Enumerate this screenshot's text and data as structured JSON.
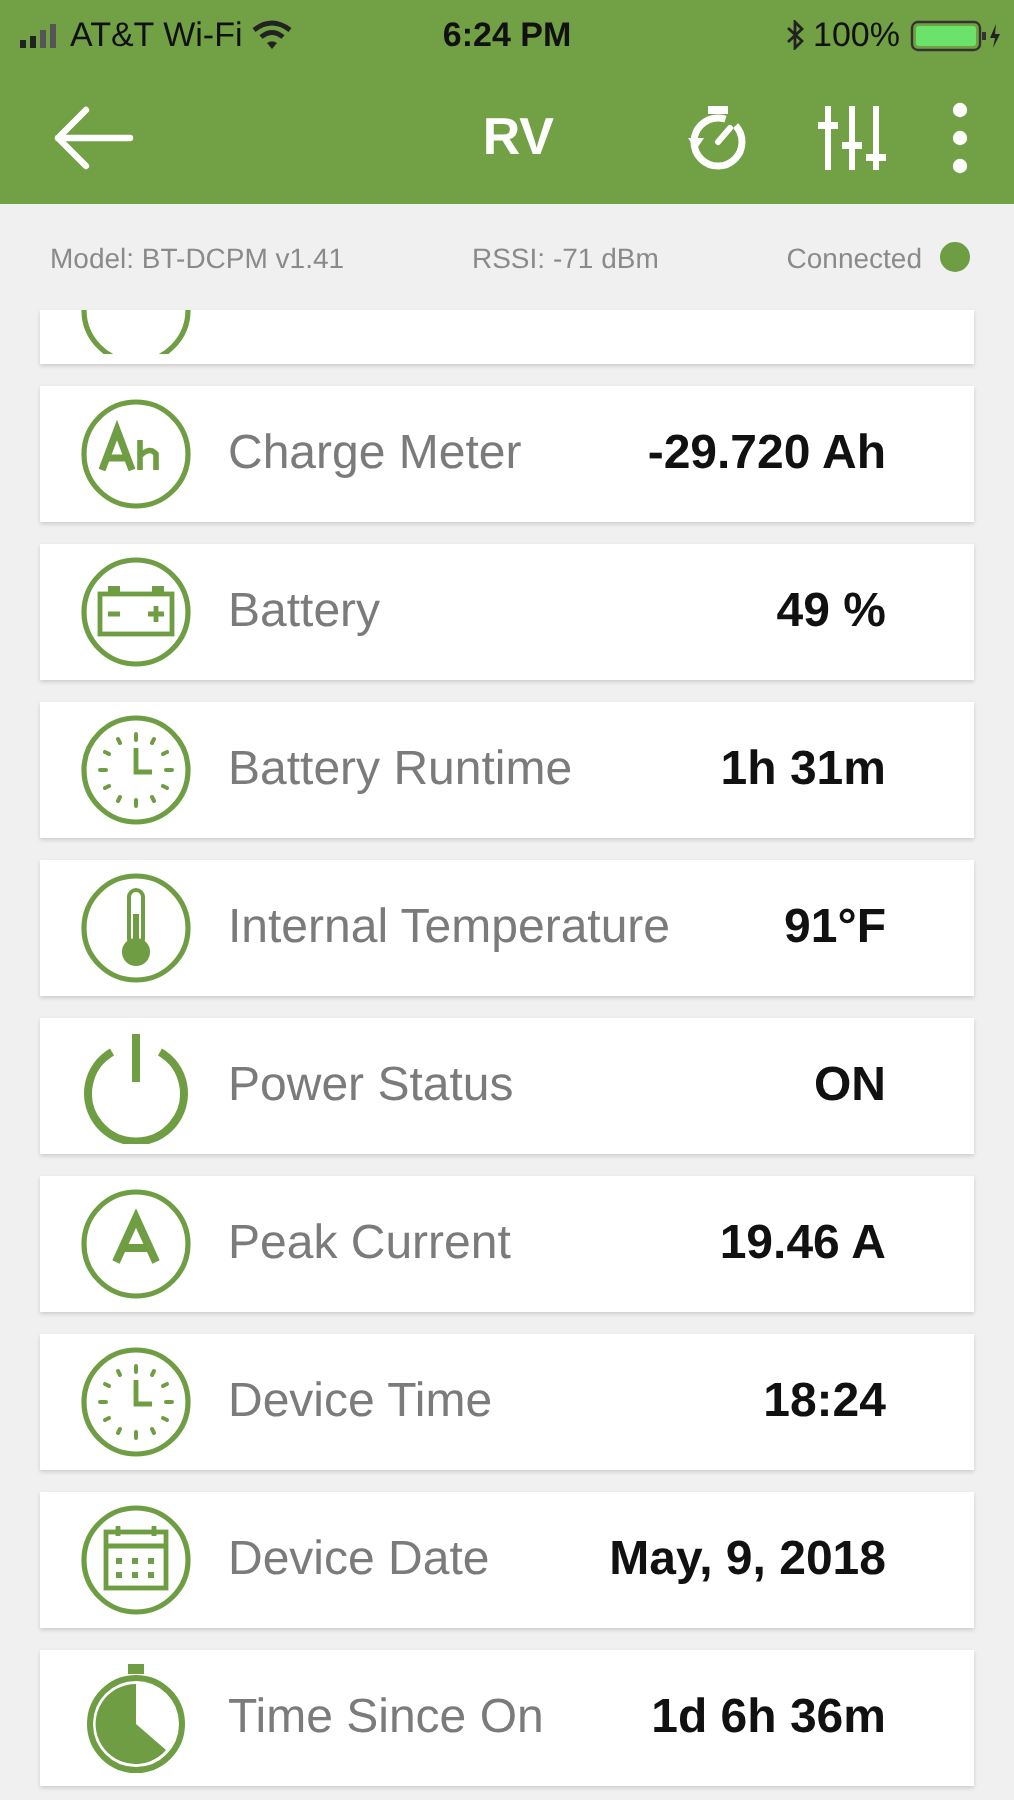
{
  "status_bar": {
    "carrier": "AT&T Wi-Fi",
    "time": "6:24 PM",
    "battery": "100%"
  },
  "app_bar": {
    "title": "RV"
  },
  "info": {
    "model": "Model: BT-DCPM v1.41",
    "rssi": "RSSI: -71 dBm",
    "connection": "Connected",
    "connected": true
  },
  "readings": [
    {
      "kind": "ah",
      "label": "Charge Meter",
      "value": "-29.720 Ah"
    },
    {
      "kind": "battery",
      "label": "Battery",
      "value": "49 %"
    },
    {
      "kind": "clock",
      "label": "Battery Runtime",
      "value": "1h 31m"
    },
    {
      "kind": "thermometer",
      "label": "Internal Temperature",
      "value": "91°F"
    },
    {
      "kind": "power",
      "label": "Power Status",
      "value": "ON"
    },
    {
      "kind": "amp",
      "label": "Peak Current",
      "value": "19.46 A"
    },
    {
      "kind": "clock",
      "label": "Device Time",
      "value": "18:24"
    },
    {
      "kind": "calendar",
      "label": "Device Date",
      "value": "May, 9, 2018"
    },
    {
      "kind": "stopwatch",
      "label": "Time Since On",
      "value": "1d 6h 36m"
    }
  ]
}
